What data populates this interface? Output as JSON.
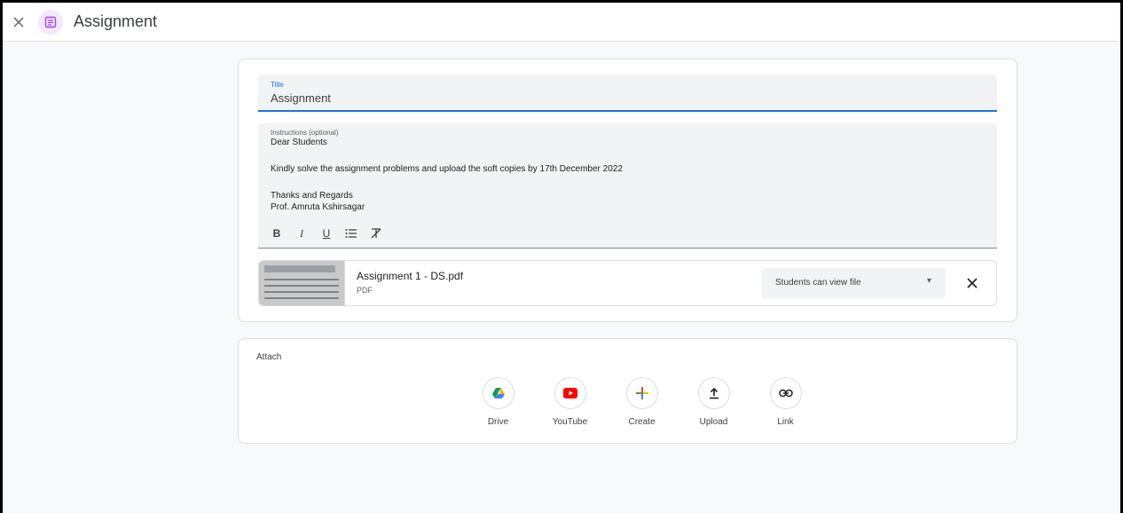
{
  "header": {
    "title": "Assignment",
    "close_icon": "close-icon",
    "app_icon": "assignment-icon",
    "app_icon_color": "#a142f4"
  },
  "form": {
    "title_label": "Title",
    "title_value": "Assignment",
    "instructions_label": "Instructions (optional)",
    "instructions_lines": [
      "Dear Students",
      "",
      "Kindly solve the assignment problems and upload the soft copies by 17th December 2022",
      "",
      "Thanks and Regards",
      "Prof. Amruta Kshirsagar"
    ],
    "format_toolbar": [
      {
        "name": "bold",
        "glyph": "B"
      },
      {
        "name": "italic",
        "glyph": "I"
      },
      {
        "name": "underline",
        "glyph": "U"
      },
      {
        "name": "bulleted-list",
        "glyph": "≡"
      },
      {
        "name": "clear-formatting",
        "glyph": "T̸"
      }
    ]
  },
  "attachment": {
    "file_name": "Assignment 1 - DS.pdf",
    "file_type": "PDF",
    "share_option": "Students can view file",
    "remove_icon": "close-icon"
  },
  "attach": {
    "title": "Attach",
    "items": [
      {
        "label": "Drive",
        "icon": "google-drive-icon"
      },
      {
        "label": "YouTube",
        "icon": "youtube-icon"
      },
      {
        "label": "Create",
        "icon": "plus-icon"
      },
      {
        "label": "Upload",
        "icon": "upload-icon"
      },
      {
        "label": "Link",
        "icon": "link-icon"
      }
    ]
  },
  "colors": {
    "accent": "#1a73e8",
    "youtube": "#ff0000",
    "drive_green": "#0f9d58",
    "drive_yellow": "#f4b400",
    "drive_blue": "#4285f4"
  }
}
